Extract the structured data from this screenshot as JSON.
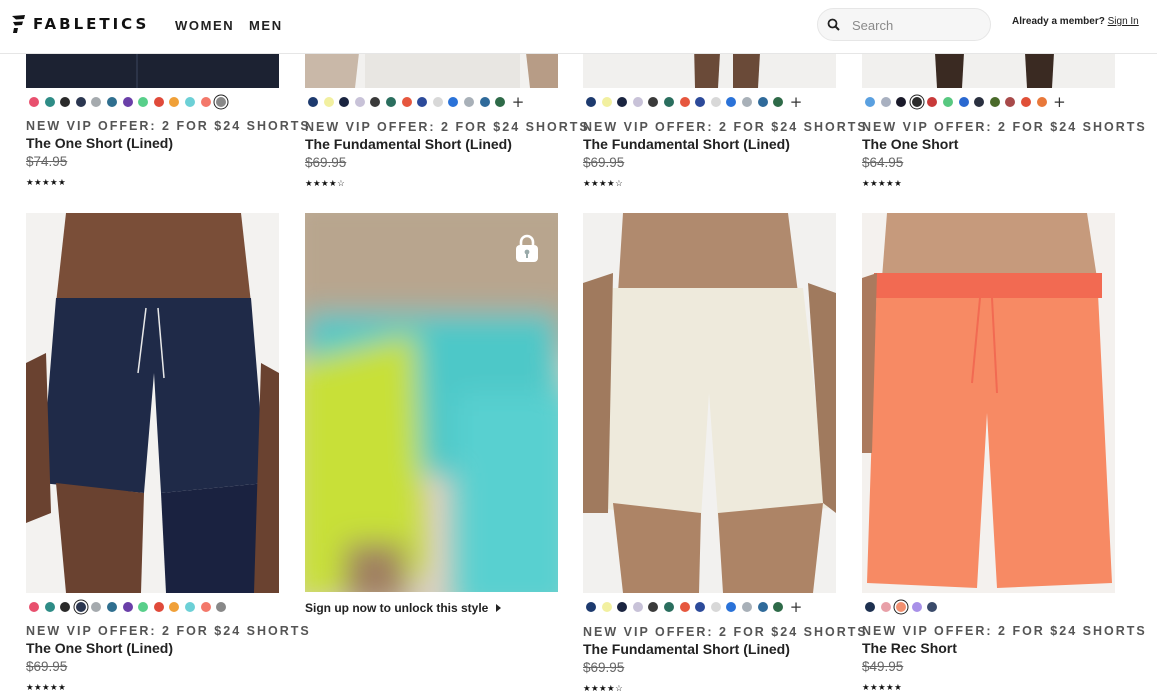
{
  "header": {
    "logo_text": "FABLETICS",
    "nav": [
      "WOMEN",
      "MEN"
    ],
    "search_placeholder": "Search",
    "member_prompt": "Already a member?",
    "sign_in": "Sign In"
  },
  "products": [
    {
      "offer": "NEW VIP OFFER: 2 FOR $24 SHORTS",
      "name": "The One Short (Lined)",
      "price": "$74.95",
      "stars": "★★★★★",
      "swatches": [
        "#e8506e",
        "#2e8c86",
        "#2a2a2a",
        "#2b3650",
        "#a5aaae",
        "#2f6f8f",
        "#6a3fa8",
        "#58cf8a",
        "#e04a3a",
        "#f0a038",
        "#6cd0d6",
        "#f3786a",
        "#888"
      ],
      "selected": 12,
      "more": false
    },
    {
      "offer": "NEW VIP OFFER: 2 FOR $24 SHORTS",
      "name": "The Fundamental Short (Lined)",
      "price": "$69.95",
      "stars": "★★★★☆",
      "swatches": [
        "#1d3a6e",
        "#f2f0a0",
        "#1a2440",
        "#c8c2d8",
        "#3a3a3a",
        "#2a6e5e",
        "#e6573e",
        "#2c4a9a",
        "#d8d8d8",
        "#2a72d8",
        "#a8b0b8",
        "#2f6a9a",
        "#2e6a48"
      ],
      "more": true
    },
    {
      "offer": "NEW VIP OFFER: 2 FOR $24 SHORTS",
      "name": "The Fundamental Short (Lined)",
      "price": "$69.95",
      "stars": "★★★★☆",
      "swatches": [
        "#1d3a6e",
        "#f2f0a0",
        "#1a2440",
        "#c8c2d8",
        "#3a3a3a",
        "#2a6e5e",
        "#e6573e",
        "#2c4a9a",
        "#d8d8d8",
        "#2a72d8",
        "#a8b0b8",
        "#2f6a9a",
        "#2e6a48"
      ],
      "more": true
    },
    {
      "offer": "NEW VIP OFFER: 2 FOR $24 SHORTS",
      "name": "The One Short",
      "price": "$64.95",
      "stars": "★★★★★",
      "swatches": [
        "#5aa0e0",
        "#a8b0c0",
        "#1a1a2a",
        "#2a2a2a",
        "#c83a3a",
        "#58c880",
        "#2a68d0",
        "#2a3040",
        "#4a6a2a",
        "#a84a4a",
        "#e05038",
        "#e8783a"
      ],
      "selected": 3,
      "more": true
    },
    {
      "offer": "NEW VIP OFFER: 2 FOR $24 SHORTS",
      "name": "The One Short (Lined)",
      "price": "$69.95",
      "stars": "★★★★★",
      "swatches": [
        "#e8506e",
        "#2e8c86",
        "#2a2a2a",
        "#2b3650",
        "#a5aaae",
        "#2f6f8f",
        "#6a3fa8",
        "#58cf8a",
        "#e04a3a",
        "#f0a038",
        "#6cd0d6",
        "#f3786a",
        "#888"
      ],
      "selected": 3,
      "more": false
    },
    {
      "unlock": "Sign up now to unlock this style"
    },
    {
      "offer": "NEW VIP OFFER: 2 FOR $24 SHORTS",
      "name": "The Fundamental Short (Lined)",
      "price": "$69.95",
      "stars": "★★★★☆",
      "swatches": [
        "#1d3a6e",
        "#f2f0a0",
        "#1a2440",
        "#c8c2d8",
        "#3a3a3a",
        "#2a6e5e",
        "#e6573e",
        "#2c4a9a",
        "#d8d8d8",
        "#2a72d8",
        "#a8b0b8",
        "#2f6a9a",
        "#2e6a48"
      ],
      "more": true
    },
    {
      "offer": "NEW VIP OFFER: 2 FOR $24 SHORTS",
      "name": "The Rec Short",
      "price": "$49.95",
      "stars": "★★★★★",
      "swatches": [
        "#1d3050",
        "#e8a0a8",
        "#f29070",
        "#a890e8",
        "#3a4a6a"
      ],
      "selected": 2,
      "more": false
    }
  ]
}
